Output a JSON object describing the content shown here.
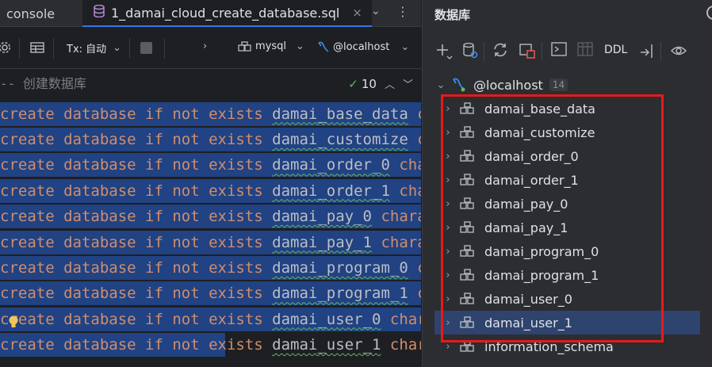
{
  "editor": {
    "tabs": {
      "console": "console",
      "active_file": "1_damai_cloud_create_database.sql",
      "close_glyph": "×",
      "more_glyph": "⌄",
      "kebab_glyph": "⋮"
    },
    "toolbar": {
      "tx_label": "Tx: 自动",
      "datasource": "mysql",
      "host": "@localhost"
    },
    "comment": "-- 创建数据库",
    "inspection_count": "10",
    "lines": [
      {
        "kw1": "create database if not exists ",
        "id": "damai_base_data",
        "tail": " charac"
      },
      {
        "kw1": "create database if not exists ",
        "id": "damai_customize",
        "tail": " charac"
      },
      {
        "kw1": "create database if not exists ",
        "id": "damai_order_0",
        "tail": " charac"
      },
      {
        "kw1": "create database if not exists ",
        "id": "damai_order_1",
        "tail": " charac"
      },
      {
        "kw1": "create database if not exists ",
        "id": "damai_pay_0",
        "tail": " charact"
      },
      {
        "kw1": "create database if not exists ",
        "id": "damai_pay_1",
        "tail": " charact"
      },
      {
        "kw1": "create database if not exists ",
        "id": "damai_program_0",
        "tail": " charac"
      },
      {
        "kw1": "create database if not exists ",
        "id": "damai_program_1",
        "tail": " charac"
      },
      {
        "kw1": "create database if not exists ",
        "id": "damai_user_0",
        "tail": " charac"
      },
      {
        "kw1": "create database if not exists ",
        "id": "damai_user_1",
        "tail": " charac"
      }
    ]
  },
  "db_panel": {
    "title": "数据库",
    "ddl_label": "DDL",
    "host": "@localhost",
    "host_count": "14",
    "schemas": [
      "damai_base_data",
      "damai_customize",
      "damai_order_0",
      "damai_order_1",
      "damai_pay_0",
      "damai_pay_1",
      "damai_program_0",
      "damai_program_1",
      "damai_user_0",
      "damai_user_1",
      "information_schema"
    ],
    "selected_schema": "damai_user_1"
  },
  "colors": {
    "selection": "#214283",
    "keyword": "#cf8e6d",
    "highlight_box": "#e8191a",
    "accent": "#3574f0"
  }
}
